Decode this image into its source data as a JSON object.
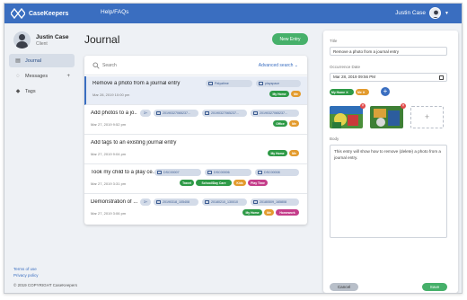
{
  "header": {
    "brand": "CaseKeepers",
    "help_link": "Help/FAQs",
    "user_name": "Justin Case"
  },
  "sidebar": {
    "profile_name": "Justin Case",
    "profile_role": "Client",
    "items": [
      {
        "label": "Journal",
        "icon": "book-icon",
        "active": true
      },
      {
        "label": "Messages",
        "icon": "chat-icon",
        "active": false
      },
      {
        "label": "Tags",
        "icon": "tag-icon",
        "active": false
      }
    ],
    "terms": "Terms of use",
    "privacy": "Privacy policy",
    "copyright": "© 2019 COPYRIGHT CaseKeepers"
  },
  "main": {
    "title": "Journal",
    "new_entry": "New Entry",
    "search_placeholder": "Search",
    "advanced_search": "Advanced search ⌄",
    "entries": [
      {
        "title": "Remove a photo from a journal entry",
        "date": "Mar 28, 2019 10:00 pm",
        "chips": [
          "Palyatime",
          "playspace"
        ],
        "tags": [
          {
            "label": "My Home",
            "color": "#2e9a47"
          },
          {
            "label": "Me",
            "color": "#e39b2e"
          }
        ]
      },
      {
        "title": "Add photos to a jo...",
        "date": "Mar 27, 2019 9:52 pm",
        "chips": [
          "3+",
          "20190327065237...",
          "20190327065237...",
          "20190327065237..."
        ],
        "tags": [
          {
            "label": "Office",
            "color": "#2e9a47"
          },
          {
            "label": "Me",
            "color": "#e39b2e"
          }
        ]
      },
      {
        "title": "Add tags to an existing journal entry",
        "date": "Mar 27, 2019 9:04 pm",
        "chips": [],
        "tags": [
          {
            "label": "My Home",
            "color": "#2e9a47"
          },
          {
            "label": "Me",
            "color": "#e39b2e"
          }
        ]
      },
      {
        "title": "Took my child to a play ce...",
        "date": "Mar 27, 2019 3:31 pm",
        "chips": [
          "DSC00007",
          "DSC00006",
          "DSC00008"
        ],
        "tags": [
          {
            "label": "Travel",
            "color": "#2e9a47"
          },
          {
            "label": "School/Day Care",
            "color": "#2e9a47"
          },
          {
            "label": "Kids",
            "color": "#e39b2e"
          },
          {
            "label": "Play Time",
            "color": "#c43d8a"
          }
        ]
      },
      {
        "title": "Demonstration of ...",
        "date": "Mar 27, 2019 3:06 pm",
        "chips": [
          "3+",
          "20190318_105408",
          "20180210_130010",
          "20180509_165808"
        ],
        "tags": [
          {
            "label": "My Home",
            "color": "#2e9a47"
          },
          {
            "label": "Me",
            "color": "#e39b2e"
          },
          {
            "label": "Homework",
            "color": "#c43d8a"
          }
        ]
      }
    ]
  },
  "detail": {
    "title_label": "Title",
    "title_value": "Remove a photo from a journal entry",
    "date_label": "Occurrence Date",
    "date_value": "Mar 28, 2019 09:56 PM",
    "tags": [
      {
        "label": "My Home ✕",
        "color": "#2e9a47"
      },
      {
        "label": "Me ✕",
        "color": "#e39b2e"
      }
    ],
    "body_label": "Body",
    "body_value": "This entry will show how to remove (delete) a photo from a journal entry.",
    "cancel": "Cancel",
    "save": "Save"
  }
}
